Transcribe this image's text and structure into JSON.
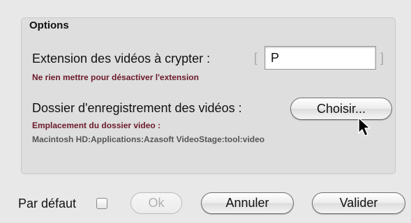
{
  "options_group": {
    "title": "Options",
    "extension": {
      "label": "Extension des vidéos à crypter :",
      "bracket_open": "[",
      "bracket_close": "]",
      "value": "P",
      "hint": "Ne rien mettre pour désactiver l'extension"
    },
    "folder": {
      "label": "Dossier d'enregistrement des vidéos :",
      "choose_button": "Choisir...",
      "location_label": "Emplacement du dossier video :",
      "path": "Macintosh HD:Applications:Azasoft VideoStage:tool:video"
    }
  },
  "footer": {
    "default_label": "Par défaut",
    "default_checked": false,
    "ok_button": "Ok",
    "cancel_button": "Annuler",
    "validate_button": "Valider"
  },
  "icons": [
    "mouse-pointer-icon"
  ]
}
